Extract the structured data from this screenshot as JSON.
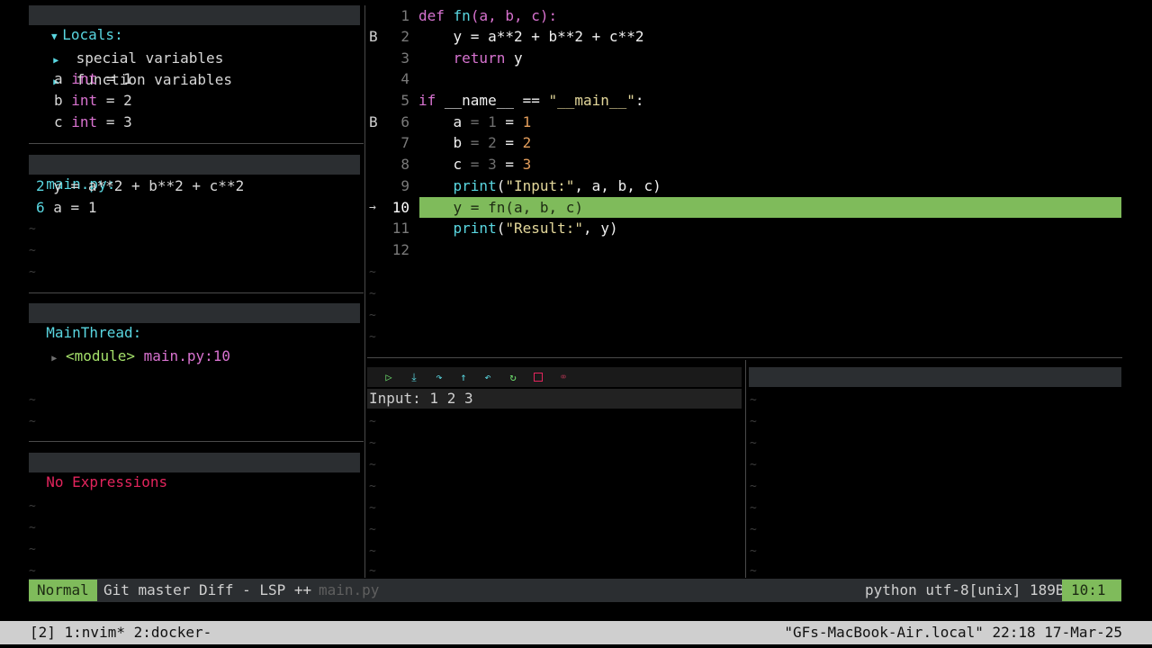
{
  "scopes": {
    "title": "Locals:",
    "tree_items": [
      "special variables",
      "function variables"
    ],
    "vars": [
      {
        "name": "a",
        "type": "int",
        "value": "= 1"
      },
      {
        "name": "b",
        "type": "int",
        "value": "= 2"
      },
      {
        "name": "c",
        "type": "int",
        "value": "= 3"
      }
    ]
  },
  "breakpoints": {
    "title": "main.py:",
    "items": [
      {
        "line": "2",
        "text": "y = a**2 + b**2 + c**2"
      },
      {
        "line": "6",
        "text": "a = 1"
      }
    ]
  },
  "threads": {
    "title": "MainThread:",
    "frame_name": "<module>",
    "frame_loc": "main.py:10"
  },
  "watches": {
    "empty": "No Expressions"
  },
  "editor": {
    "line_numbers": [
      "1",
      "2",
      "3",
      "4",
      "5",
      "6",
      "7",
      "8",
      "9",
      "10",
      "11",
      "12"
    ],
    "breakpoint_sign": "B",
    "current_sign": "→",
    "lines": {
      "l1_kw": "def",
      "l1_fn": "fn",
      "l1_args": "(a, b, c):",
      "l2": "    y = a**2 + b**2 + c**2",
      "l3_kw": "return",
      "l3_rest": " y",
      "l5_kw": "if",
      "l5_rest": " __name__ == ",
      "l5_str": "\"__main__\"",
      "l5_colon": ":",
      "l6_var": "a",
      "l6_virt": " = 1",
      "l6_assign": " = ",
      "l6_num": "1",
      "l7_var": "b",
      "l7_virt": " = 2",
      "l7_assign": " = ",
      "l7_num": "2",
      "l8_var": "c",
      "l8_virt": " = 3",
      "l8_assign": " = ",
      "l8_num": "3",
      "l9_fn": "print",
      "l9_open": "(",
      "l9_str": "\"Input:\"",
      "l9_rest": ", a, b, c)",
      "l10": "    y = fn(a, b, c)",
      "l11_fn": "print",
      "l11_open": "(",
      "l11_str": "\"Result:\"",
      "l11_rest": ", y)"
    }
  },
  "repl": {
    "output": "Input: 1 2 3"
  },
  "controls": {
    "continue": "play-icon",
    "step_into": "step-into-icon",
    "step_over": "step-over-icon",
    "step_out": "step-out-icon",
    "step_back": "step-back-icon",
    "restart": "restart-icon",
    "stop": "stop-icon",
    "disconnect": "disconnect-icon"
  },
  "statusline": {
    "mode": "Normal",
    "git": "Git master Diff - LSP ++",
    "file": "main.py",
    "fileinfo": "python utf-8[unix] 189B",
    "position": "10:1"
  },
  "tmux": {
    "left": "[2] 1:nvim* 2:docker-",
    "right": "\"GFs-MacBook-Air.local\" 22:18 17-Mar-25"
  },
  "colors": {
    "mode_bg": "#7fbb5b",
    "current_line_bg": "#7fbb5b",
    "accent_cyan": "#59d6e0",
    "keyword": "#d773d0",
    "error": "#e2245c"
  }
}
